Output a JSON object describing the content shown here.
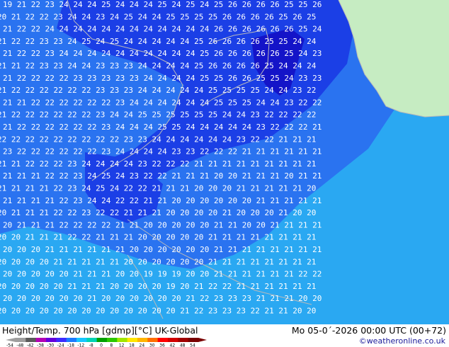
{
  "footer": {
    "title": "Height/Temp. 700 hPa [gdmp][°C] UK-Global",
    "valid": "Mo 05-0´-2026 00:00 UTC (00+72)",
    "credit": "©weatheronline.co.uk"
  },
  "colorbar": {
    "labels": [
      "-54",
      "-48",
      "-42",
      "-38",
      "-30",
      "-24",
      "-18",
      "-12",
      "-8",
      "0",
      "8",
      "12",
      "18",
      "24",
      "30",
      "36",
      "42",
      "48",
      "54"
    ],
    "colors": [
      "#9e9e9e",
      "#5a5a5a",
      "#b400b4",
      "#6400dc",
      "#3c2bff",
      "#1b7bff",
      "#17c6ff",
      "#00d2b4",
      "#00a000",
      "#2cc800",
      "#a0e600",
      "#ffe600",
      "#ffb400",
      "#ff6e00",
      "#ff0000",
      "#d20000",
      "#a00000",
      "#780000"
    ]
  },
  "map": {
    "colors": {
      "land": "#c6ecc2",
      "ocean_light": "#2aa8f2",
      "ocean_mid": "#2a73f0",
      "ocean_deep": "#1b3fe6",
      "cold_core": "#1414c8",
      "label_color": "#ffffff",
      "coast_color": "#b9b9b9"
    },
    "rows": [
      {
        "text": "19 21 22 23 24 24 24 25 24 24 24 25 24 25 24 25 26 26 26 26 25 25 26"
      },
      {
        "text": "20 21 22 22 23 24 24 23 24 25 24 24 25 25 25 25 26 26 26 26 25 26 25"
      },
      {
        "text": "21 22 22 24 24 24 24 24 24 24 24 24 24 24 24 26 26 26 26 26 26 25 24"
      },
      {
        "text": "21 22 22 23 23 24 25 24 25 24 24 24 24 24 25 26 26 26 26 25 25 24 24"
      },
      {
        "text": "21 22 22 23 24 24 24 24 24 24 24 24 24 24 25 26 26 26 26 26 25 24 23"
      },
      {
        "text": "21 21 22 23 23 24 24 23 23 23 24 24 24 24 25 26 26 26 26 25 24 24 24"
      },
      {
        "text": "21 22 22 22 22 23 23 23 23 23 24 24 24 24 25 25 26 26 25 25 24 23 23"
      },
      {
        "text": "21 22 22 22 22 22 22 23 23 23 24 24 24 24 24 25 25 25 25 24 24 23 22"
      },
      {
        "text": "21 21 22 22 22 22 22 22 23 24 24 24 24 24 24 25 25 25 24 24 23 22 22"
      },
      {
        "text": "21 22 22 22 22 22 22 23 24 24 25 25 25 25 25 25 24 24 23 22 22 22 22"
      },
      {
        "text": "21 22 22 22 22 22 22 23 24 24 24 25 25 24 24 24 24 24 23 22 22 22 21"
      },
      {
        "text": "22 22 22 22 22 22 22 22 22 23 23 24 24 24 24 24 24 23 22 22 21 21 21"
      },
      {
        "text": "23 22 22 22 22 22 22 23 24 24 24 24 23 23 22 22 22 21 21 21 21 21 21"
      },
      {
        "text": "21 21 22 22 22 23 24 24 24 24 23 22 22 22 21 21 21 21 21 21 21 21 21"
      },
      {
        "text": "21 21 21 22 22 23 24 25 24 23 22 22 21 21 21 20 20 21 21 21 20 21 21"
      },
      {
        "text": "21 21 21 21 22 23 24 25 24 22 22 21 21 21 20 20 20 21 21 21 21 21 20"
      },
      {
        "text": "21 21 21 21 22 23 24 24 22 22 21 21 20 20 20 20 20 20 21 21 21 21 21"
      },
      {
        "text": "20 21 21 21 22 22 23 22 22 21 21 21 20 20 20 20 21 20 20 20 21 20 20"
      },
      {
        "text": "20 21 21 21 22 22 22 22 21 21 20 20 20 20 20 21 21 20 20 21 21 21 21"
      },
      {
        "text": "20 20 21 21 21 22 22 21 21 21 20 20 20 20 20 21 21 21 21 21 21 21 21"
      },
      {
        "text": "20 20 20 21 21 21 21 21 21 20 20 20 20 20 20 21 21 21 21 21 21 21 21"
      },
      {
        "text": "20 20 20 20 21 21 21 21 21 20 20 20 20 20 20 21 21 21 21 21 21 21 21"
      },
      {
        "text": "20 20 20 20 20 21 21 21 20 20 19 19 19 20 20 21 21 21 21 21 21 22 22"
      },
      {
        "text": "20 20 20 20 20 21 21 21 20 20 20 20 19 20 21 22 22 21 21 21 21 21 21"
      },
      {
        "text": "20 20 20 20 20 20 21 20 20 20 20 20 20 21 22 23 23 23 21 21 21 20 20"
      },
      {
        "text": "20 20 20 20 20 20 20 20 20 20 20 20 20 21 22 23 23 23 22 21 21 20 20"
      }
    ]
  }
}
